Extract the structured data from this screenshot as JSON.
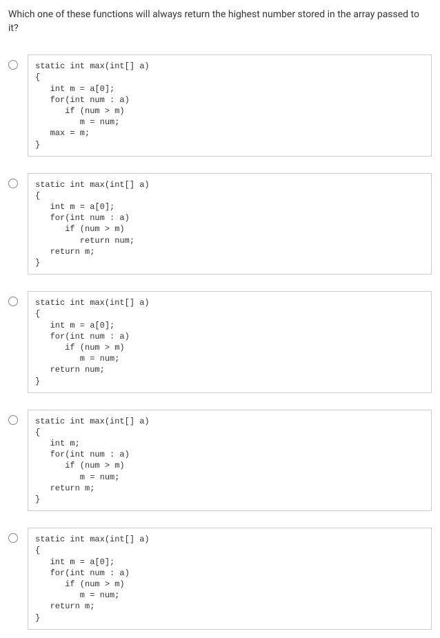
{
  "question": "Which one of these functions will always return the highest number stored in the array passed to it?",
  "options": [
    {
      "code": "static int max(int[] a)\n{\n   int m = a[0];\n   for(int num : a)\n      if (num > m)\n         m = num;\n   max = m;\n}"
    },
    {
      "code": "static int max(int[] a)\n{\n   int m = a[0];\n   for(int num : a)\n      if (num > m)\n         return num;\n   return m;\n}"
    },
    {
      "code": "static int max(int[] a)\n{\n   int m = a[0];\n   for(int num : a)\n      if (num > m)\n         m = num;\n   return num;\n}"
    },
    {
      "code": "static int max(int[] a)\n{\n   int m;\n   for(int num : a)\n      if (num > m)\n         m = num;\n   return m;\n}"
    },
    {
      "code": "static int max(int[] a)\n{\n   int m = a[0];\n   for(int num : a)\n      if (num > m)\n         m = num;\n   return m;\n}"
    }
  ]
}
